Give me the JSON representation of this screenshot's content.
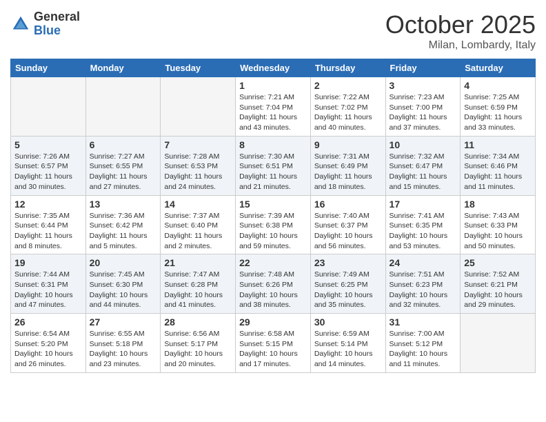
{
  "header": {
    "logo_general": "General",
    "logo_blue": "Blue",
    "title": "October 2025",
    "subtitle": "Milan, Lombardy, Italy"
  },
  "days_of_week": [
    "Sunday",
    "Monday",
    "Tuesday",
    "Wednesday",
    "Thursday",
    "Friday",
    "Saturday"
  ],
  "weeks": [
    [
      {
        "day": "",
        "info": ""
      },
      {
        "day": "",
        "info": ""
      },
      {
        "day": "",
        "info": ""
      },
      {
        "day": "1",
        "info": "Sunrise: 7:21 AM\nSunset: 7:04 PM\nDaylight: 11 hours\nand 43 minutes."
      },
      {
        "day": "2",
        "info": "Sunrise: 7:22 AM\nSunset: 7:02 PM\nDaylight: 11 hours\nand 40 minutes."
      },
      {
        "day": "3",
        "info": "Sunrise: 7:23 AM\nSunset: 7:00 PM\nDaylight: 11 hours\nand 37 minutes."
      },
      {
        "day": "4",
        "info": "Sunrise: 7:25 AM\nSunset: 6:59 PM\nDaylight: 11 hours\nand 33 minutes."
      }
    ],
    [
      {
        "day": "5",
        "info": "Sunrise: 7:26 AM\nSunset: 6:57 PM\nDaylight: 11 hours\nand 30 minutes."
      },
      {
        "day": "6",
        "info": "Sunrise: 7:27 AM\nSunset: 6:55 PM\nDaylight: 11 hours\nand 27 minutes."
      },
      {
        "day": "7",
        "info": "Sunrise: 7:28 AM\nSunset: 6:53 PM\nDaylight: 11 hours\nand 24 minutes."
      },
      {
        "day": "8",
        "info": "Sunrise: 7:30 AM\nSunset: 6:51 PM\nDaylight: 11 hours\nand 21 minutes."
      },
      {
        "day": "9",
        "info": "Sunrise: 7:31 AM\nSunset: 6:49 PM\nDaylight: 11 hours\nand 18 minutes."
      },
      {
        "day": "10",
        "info": "Sunrise: 7:32 AM\nSunset: 6:47 PM\nDaylight: 11 hours\nand 15 minutes."
      },
      {
        "day": "11",
        "info": "Sunrise: 7:34 AM\nSunset: 6:46 PM\nDaylight: 11 hours\nand 11 minutes."
      }
    ],
    [
      {
        "day": "12",
        "info": "Sunrise: 7:35 AM\nSunset: 6:44 PM\nDaylight: 11 hours\nand 8 minutes."
      },
      {
        "day": "13",
        "info": "Sunrise: 7:36 AM\nSunset: 6:42 PM\nDaylight: 11 hours\nand 5 minutes."
      },
      {
        "day": "14",
        "info": "Sunrise: 7:37 AM\nSunset: 6:40 PM\nDaylight: 11 hours\nand 2 minutes."
      },
      {
        "day": "15",
        "info": "Sunrise: 7:39 AM\nSunset: 6:38 PM\nDaylight: 10 hours\nand 59 minutes."
      },
      {
        "day": "16",
        "info": "Sunrise: 7:40 AM\nSunset: 6:37 PM\nDaylight: 10 hours\nand 56 minutes."
      },
      {
        "day": "17",
        "info": "Sunrise: 7:41 AM\nSunset: 6:35 PM\nDaylight: 10 hours\nand 53 minutes."
      },
      {
        "day": "18",
        "info": "Sunrise: 7:43 AM\nSunset: 6:33 PM\nDaylight: 10 hours\nand 50 minutes."
      }
    ],
    [
      {
        "day": "19",
        "info": "Sunrise: 7:44 AM\nSunset: 6:31 PM\nDaylight: 10 hours\nand 47 minutes."
      },
      {
        "day": "20",
        "info": "Sunrise: 7:45 AM\nSunset: 6:30 PM\nDaylight: 10 hours\nand 44 minutes."
      },
      {
        "day": "21",
        "info": "Sunrise: 7:47 AM\nSunset: 6:28 PM\nDaylight: 10 hours\nand 41 minutes."
      },
      {
        "day": "22",
        "info": "Sunrise: 7:48 AM\nSunset: 6:26 PM\nDaylight: 10 hours\nand 38 minutes."
      },
      {
        "day": "23",
        "info": "Sunrise: 7:49 AM\nSunset: 6:25 PM\nDaylight: 10 hours\nand 35 minutes."
      },
      {
        "day": "24",
        "info": "Sunrise: 7:51 AM\nSunset: 6:23 PM\nDaylight: 10 hours\nand 32 minutes."
      },
      {
        "day": "25",
        "info": "Sunrise: 7:52 AM\nSunset: 6:21 PM\nDaylight: 10 hours\nand 29 minutes."
      }
    ],
    [
      {
        "day": "26",
        "info": "Sunrise: 6:54 AM\nSunset: 5:20 PM\nDaylight: 10 hours\nand 26 minutes."
      },
      {
        "day": "27",
        "info": "Sunrise: 6:55 AM\nSunset: 5:18 PM\nDaylight: 10 hours\nand 23 minutes."
      },
      {
        "day": "28",
        "info": "Sunrise: 6:56 AM\nSunset: 5:17 PM\nDaylight: 10 hours\nand 20 minutes."
      },
      {
        "day": "29",
        "info": "Sunrise: 6:58 AM\nSunset: 5:15 PM\nDaylight: 10 hours\nand 17 minutes."
      },
      {
        "day": "30",
        "info": "Sunrise: 6:59 AM\nSunset: 5:14 PM\nDaylight: 10 hours\nand 14 minutes."
      },
      {
        "day": "31",
        "info": "Sunrise: 7:00 AM\nSunset: 5:12 PM\nDaylight: 10 hours\nand 11 minutes."
      },
      {
        "day": "",
        "info": ""
      }
    ]
  ]
}
